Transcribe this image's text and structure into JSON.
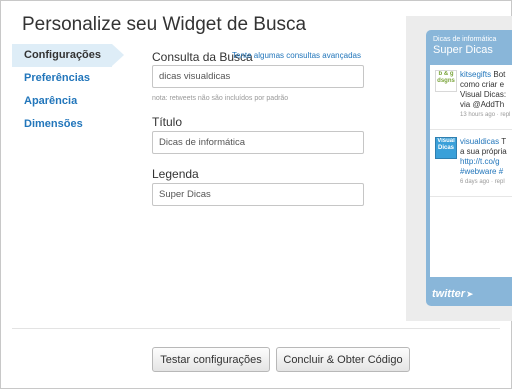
{
  "page": {
    "title": "Personalize seu Widget de Busca"
  },
  "nav": {
    "items": [
      {
        "label": "Configurações",
        "active": true
      },
      {
        "label": "Preferências",
        "active": false
      },
      {
        "label": "Aparência",
        "active": false
      },
      {
        "label": "Dimensões",
        "active": false
      }
    ]
  },
  "form": {
    "query": {
      "label": "Consulta da Busca",
      "advanced_link": "Tente algumas consultas avançadas",
      "value": "dicas visualdicas",
      "note": "nota: retweets não são incluídos por padrão"
    },
    "title": {
      "label": "Título",
      "value": "Dicas de informática"
    },
    "caption": {
      "label": "Legenda",
      "value": "Super Dicas"
    }
  },
  "preview": {
    "header_sub": "Dicas de informática",
    "header_title": "Super Dicas",
    "tweets": [
      {
        "avatar_text": "b & g dsgns",
        "user": "kitsegifts",
        "lines": [
          "Bot",
          "como criar e",
          "Visual Dicas:",
          "via @AddTh"
        ],
        "meta": "13 hours ago · repl"
      },
      {
        "avatar_text": "Visual Dicas",
        "user": "visualdicas",
        "lines": [
          "T",
          "a sua própria",
          "http://t.co/g",
          "#webware #"
        ],
        "meta": "6 days ago · repl"
      }
    ],
    "footer_logo": "twitter"
  },
  "actions": {
    "test_label": "Testar configurações",
    "finish_label": "Concluir & Obter Código"
  },
  "colors": {
    "link": "#2276bb",
    "nav_active_bg": "#deedf7",
    "widget_blue": "#89b6d9"
  }
}
